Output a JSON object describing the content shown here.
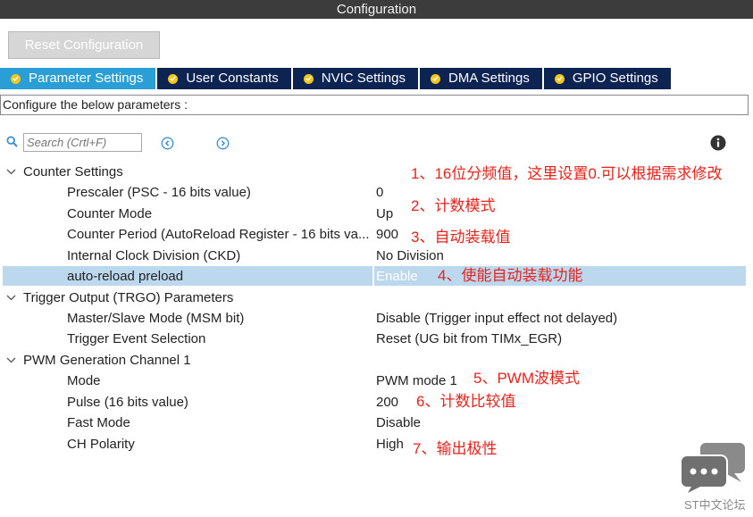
{
  "window": {
    "title": "Configuration"
  },
  "toolbar": {
    "reset_label": "Reset Configuration"
  },
  "tabs": [
    {
      "label": "Parameter Settings",
      "active": true
    },
    {
      "label": "User Constants",
      "active": false
    },
    {
      "label": "NVIC Settings",
      "active": false
    },
    {
      "label": "DMA Settings",
      "active": false
    },
    {
      "label": "GPIO Settings",
      "active": false
    }
  ],
  "description": "Configure the below parameters :",
  "search": {
    "placeholder": "Search (Crtl+F)"
  },
  "groups": {
    "counter": {
      "name": "Counter Settings",
      "params": [
        {
          "name": "Prescaler (PSC - 16 bits value)",
          "value": "0"
        },
        {
          "name": "Counter Mode",
          "value": "Up"
        },
        {
          "name": "Counter Period (AutoReload Register - 16 bits va...",
          "value": "900"
        },
        {
          "name": "Internal Clock Division (CKD)",
          "value": "No Division"
        },
        {
          "name": "auto-reload preload",
          "value": "Enable",
          "selected": true
        }
      ]
    },
    "trgo": {
      "name": "Trigger Output (TRGO) Parameters",
      "params": [
        {
          "name": "Master/Slave Mode (MSM bit)",
          "value": "Disable (Trigger input effect not delayed)"
        },
        {
          "name": "Trigger Event Selection",
          "value": "Reset (UG bit from TIMx_EGR)"
        }
      ]
    },
    "pwm": {
      "name": "PWM Generation Channel 1",
      "params": [
        {
          "name": "Mode",
          "value": "PWM mode 1"
        },
        {
          "name": "Pulse (16 bits value)",
          "value": "200"
        },
        {
          "name": "Fast Mode",
          "value": "Disable"
        },
        {
          "name": "CH Polarity",
          "value": "High"
        }
      ]
    }
  },
  "annotations": [
    "1、16位分频值，这里设置0.可以根据需求修改",
    "2、计数模式",
    "3、自动装载值",
    "4、使能自动装载功能",
    "5、PWM波模式",
    "6、计数比较值",
    "7、输出极性"
  ],
  "watermark": {
    "text": "ST中文论坛"
  },
  "colors": {
    "tab_active": "#2a9fd6",
    "tab_inactive": "#0d2352",
    "selection": "#bcd8ee",
    "annotation": "#e8231c",
    "check": "#f5c518"
  }
}
